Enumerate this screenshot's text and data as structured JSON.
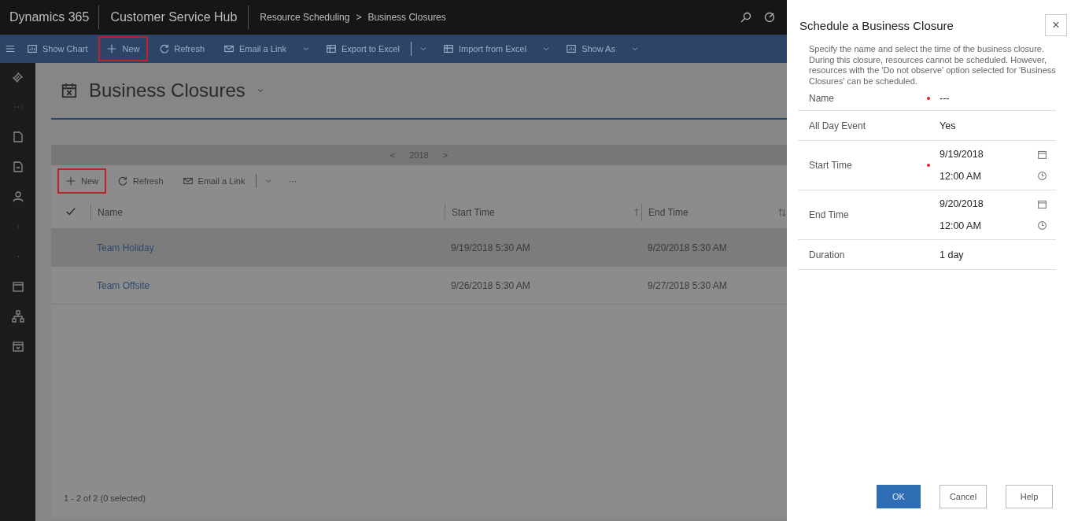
{
  "top_bar": {
    "app": "Dynamics 365",
    "area": "Customer Service Hub",
    "breadcrumb": [
      {
        "label": "Resource Scheduling"
      },
      {
        "label": "Business Closures"
      }
    ],
    "separator": ">"
  },
  "command_bar": [
    {
      "kind": "chart",
      "label": "Show Chart",
      "highlighted": false,
      "dropdown": false
    },
    {
      "kind": "add",
      "label": "New",
      "highlighted": true,
      "dropdown": false
    },
    {
      "kind": "refresh",
      "label": "Refresh",
      "highlighted": false,
      "dropdown": false
    },
    {
      "kind": "mail",
      "label": "Email a Link",
      "highlighted": false,
      "dropdown": true
    },
    {
      "kind": "excel",
      "label": "Export to Excel",
      "highlighted": false,
      "dropdown": true
    },
    {
      "kind": "excel",
      "label": "Import from Excel",
      "highlighted": false,
      "dropdown": true
    },
    {
      "kind": "chart",
      "label": "Show As",
      "highlighted": false,
      "dropdown": true
    }
  ],
  "page": {
    "title": "Business Closures"
  },
  "grid": {
    "year": "2018",
    "prev": "<",
    "next": ">",
    "toolbar": [
      {
        "kind": "add",
        "label": "New",
        "highlighted": true,
        "dropdown": false
      },
      {
        "kind": "refresh",
        "label": "Refresh",
        "highlighted": false,
        "dropdown": false
      },
      {
        "kind": "mail",
        "label": "Email a Link",
        "highlighted": false,
        "dropdown": true
      },
      {
        "kind": "more",
        "label": "···",
        "highlighted": false,
        "dropdown": false
      }
    ],
    "columns": [
      {
        "label": "Name",
        "sorted": false,
        "filtered": false
      },
      {
        "label": "Start Time",
        "sorted": true,
        "filtered": false
      },
      {
        "label": "End Time",
        "sorted": true,
        "filtered": true
      }
    ],
    "rows": [
      {
        "selected": true,
        "cells": [
          "Team Holiday",
          "9/19/2018 5:30 AM",
          "9/20/2018 5:30 AM"
        ]
      },
      {
        "selected": false,
        "cells": [
          "Team Offsite",
          "9/26/2018 5:30 AM",
          "9/27/2018 5:30 AM"
        ]
      }
    ],
    "footer": "1 - 2 of 2 (0 selected)"
  },
  "dialog": {
    "title": "Schedule a Business Closure",
    "close": "×",
    "description": [
      "Specify the name and select the time of the business closure.",
      "During this closure, resources cannot be scheduled. However, resources with the 'Do not observe' option selected for 'Business Closures' can be scheduled."
    ],
    "fields": [
      {
        "kind": "text",
        "label": "Name",
        "required": true,
        "value": "---"
      },
      {
        "kind": "text",
        "label": "All Day Event",
        "required": false,
        "value": "Yes"
      },
      {
        "kind": "datetime",
        "label": "Start Time",
        "required": true,
        "date": "9/19/2018",
        "time": "12:00 AM"
      },
      {
        "kind": "datetime",
        "label": "End Time",
        "required": false,
        "date": "9/20/2018",
        "time": "12:00 AM"
      },
      {
        "kind": "text",
        "label": "Duration",
        "required": false,
        "value": "1 day"
      }
    ],
    "buttons": [
      {
        "label": "OK",
        "primary": true
      },
      {
        "label": "Cancel",
        "primary": false
      },
      {
        "label": "Help",
        "primary": false
      }
    ]
  }
}
